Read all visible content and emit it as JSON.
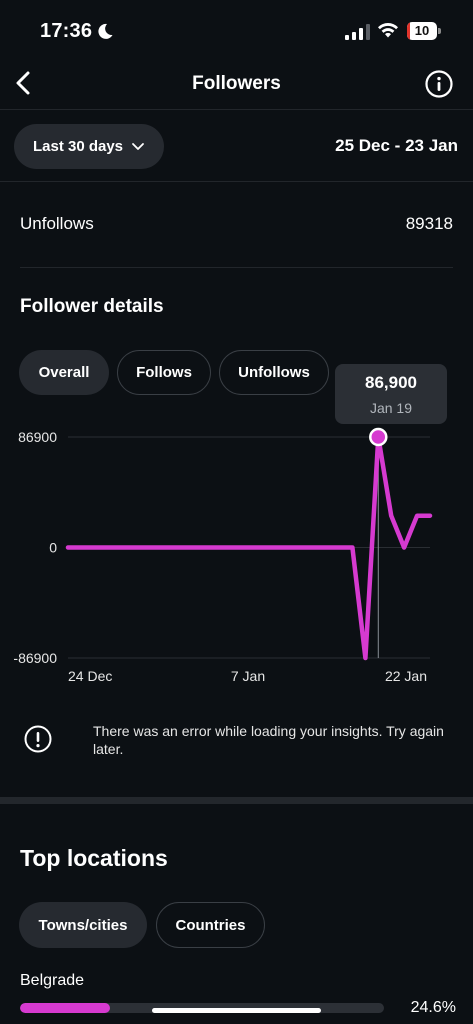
{
  "status_bar": {
    "time": "17:36",
    "battery_level": "10",
    "battery_fraction": 0.1
  },
  "header": {
    "title": "Followers",
    "back_icon": "chevron-left-icon",
    "info_icon": "info-icon"
  },
  "filter": {
    "range_label": "Last 30 days",
    "date_range": "25 Dec - 23 Jan"
  },
  "unfollows": {
    "label": "Unfollows",
    "value": "89318"
  },
  "follower_details": {
    "title": "Follower details",
    "tabs": [
      {
        "label": "Overall",
        "active": true
      },
      {
        "label": "Follows",
        "active": false
      },
      {
        "label": "Unfollows",
        "active": false
      }
    ],
    "tooltip": {
      "value": "86,900",
      "date": "Jan 19"
    }
  },
  "chart_data": {
    "type": "line",
    "y_ticks": [
      "86900",
      "0",
      "-86900"
    ],
    "x_ticks": [
      "24 Dec",
      "7 Jan",
      "22 Jan"
    ],
    "ylim": [
      -86900,
      86900
    ],
    "x": [
      0,
      22,
      23,
      24,
      25,
      26,
      27,
      28
    ],
    "values": [
      0,
      0,
      -86900,
      86900,
      25000,
      0,
      25000,
      25000
    ],
    "highlight_index": 3,
    "series_color": "#d63ad0"
  },
  "error": {
    "message": "There was an error while loading your insights. Try again later."
  },
  "top_locations": {
    "title": "Top locations",
    "tabs": [
      {
        "label": "Towns/cities",
        "active": true
      },
      {
        "label": "Countries",
        "active": false
      }
    ],
    "items": [
      {
        "name": "Belgrade",
        "percent": "24.6%",
        "fraction": 0.246
      }
    ]
  }
}
